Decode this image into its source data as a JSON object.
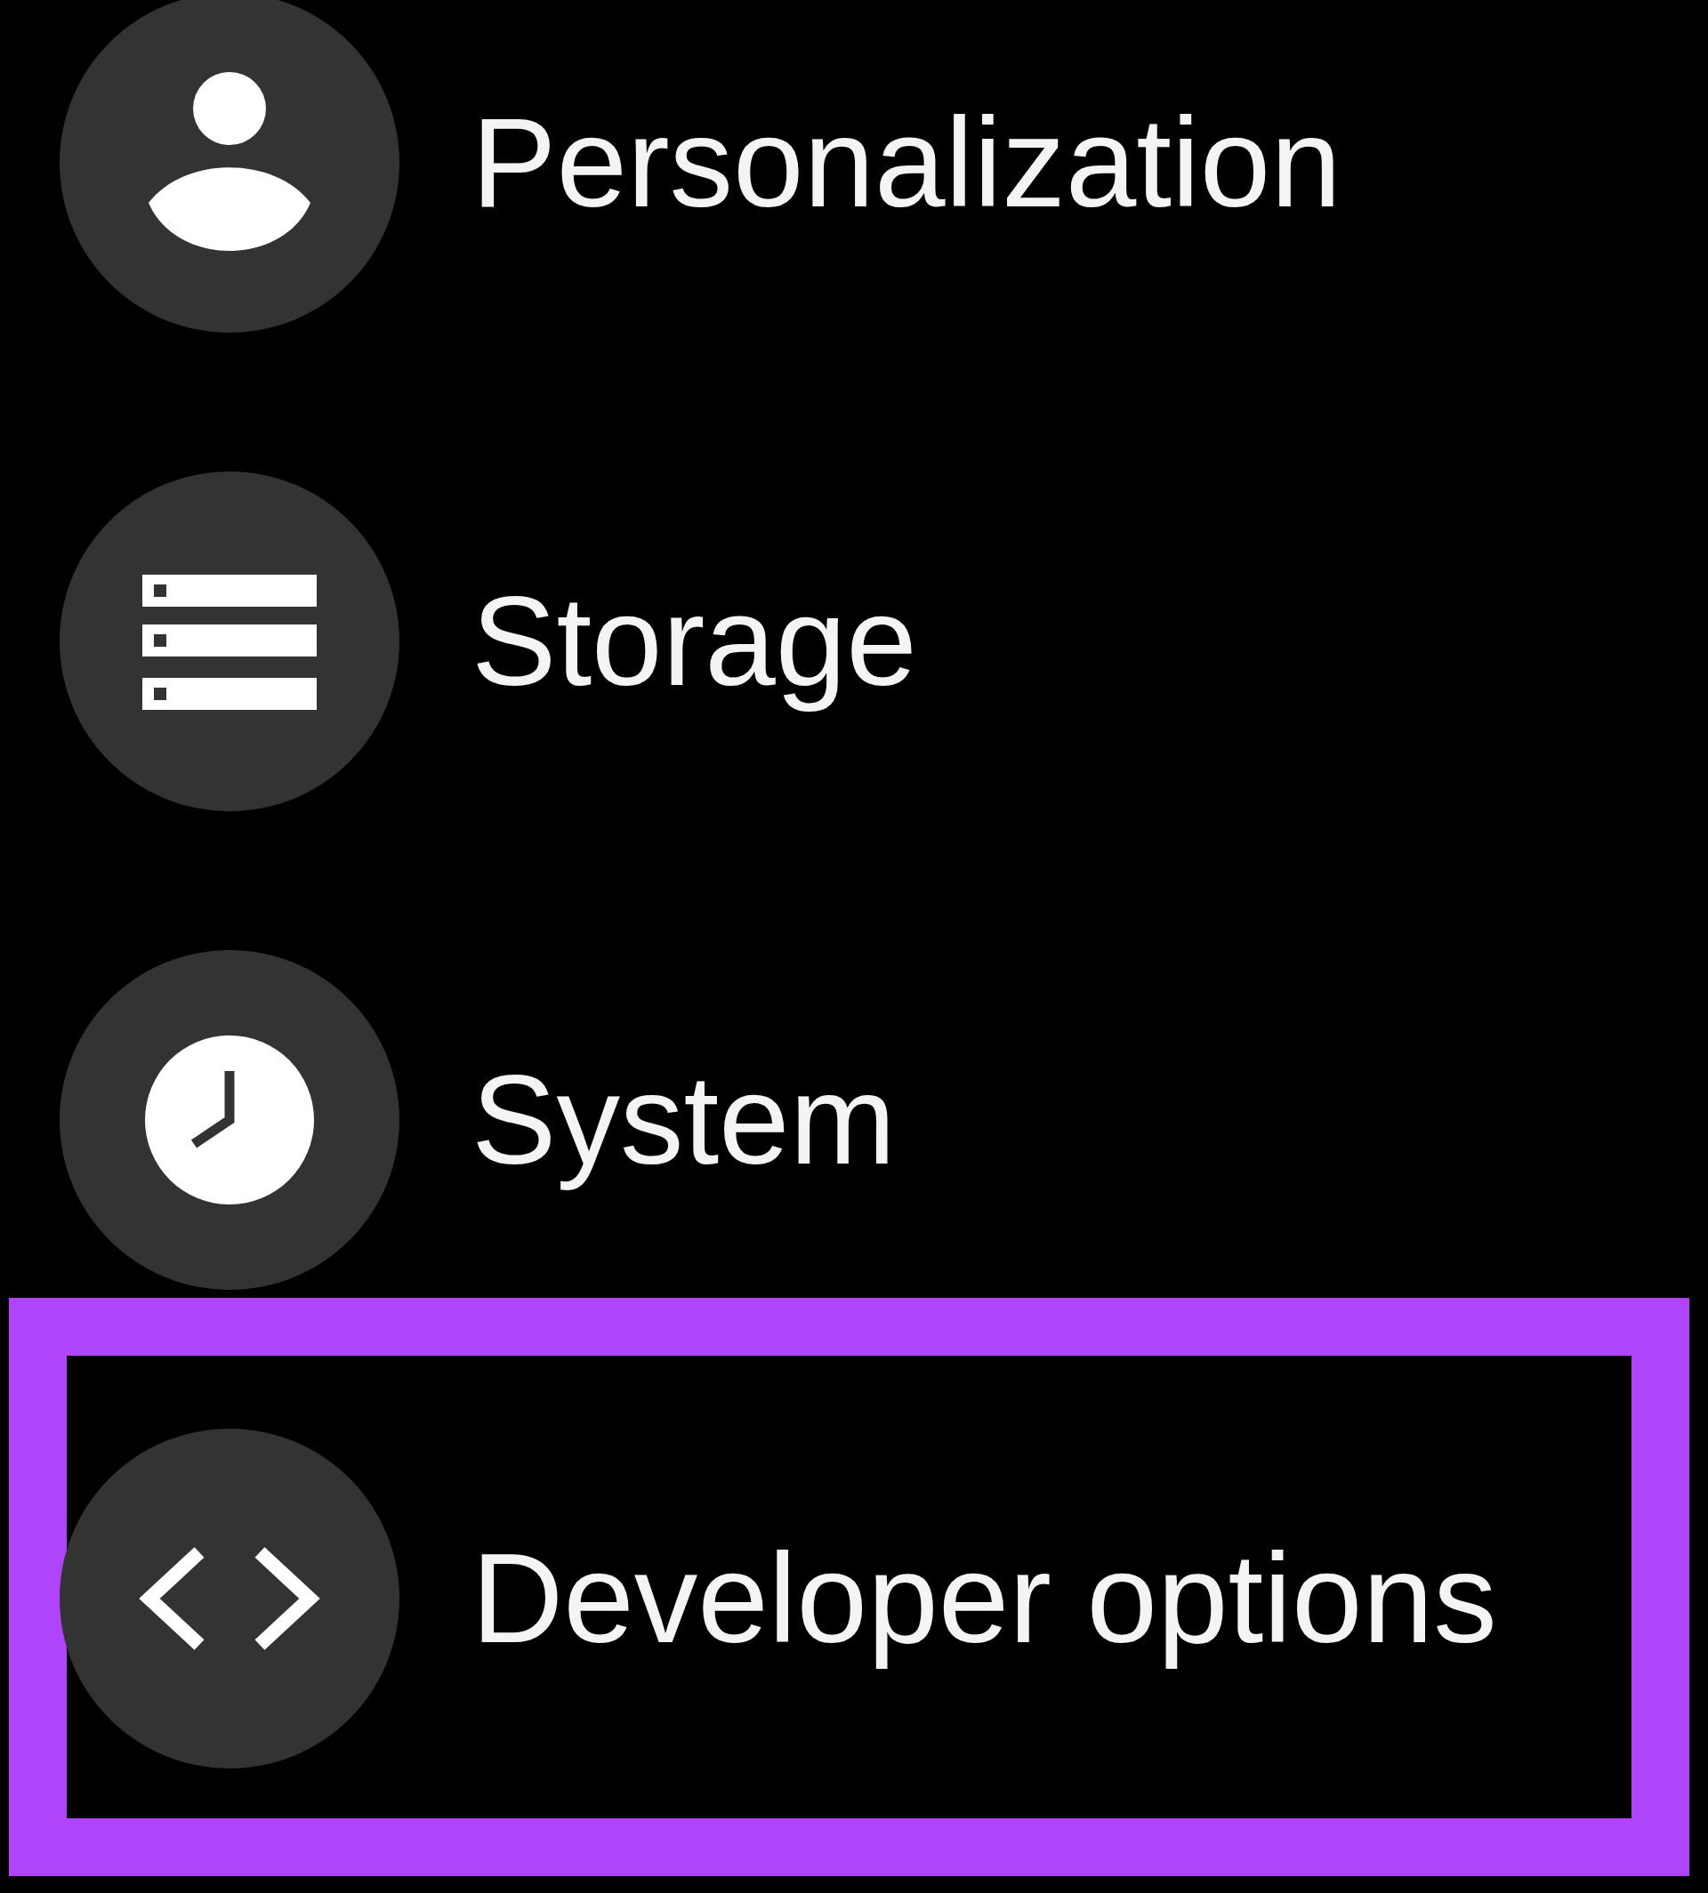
{
  "items": [
    {
      "label": "Personalization",
      "highlighted": false
    },
    {
      "label": "Storage",
      "highlighted": false
    },
    {
      "label": "System",
      "highlighted": false
    },
    {
      "label": "Developer options",
      "highlighted": true
    }
  ]
}
